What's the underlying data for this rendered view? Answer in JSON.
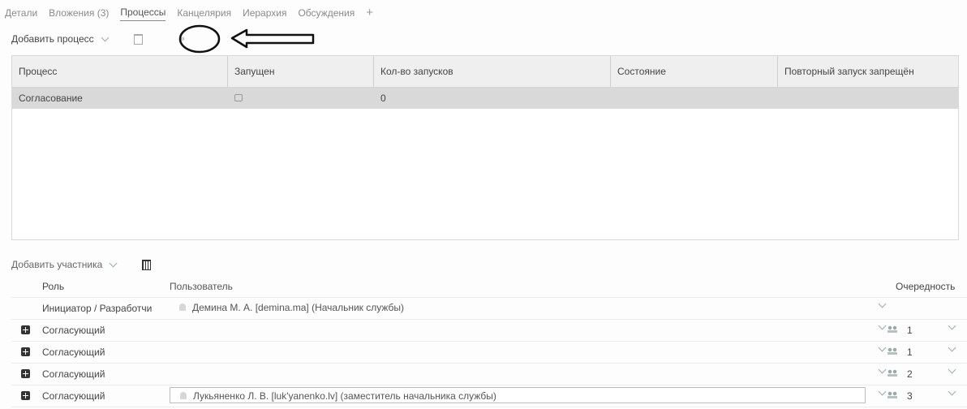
{
  "tabs": [
    {
      "label": "Детали"
    },
    {
      "label": "Вложения (3)"
    },
    {
      "label": "Процессы"
    },
    {
      "label": "Канцелярия"
    },
    {
      "label": "Иерархия"
    },
    {
      "label": "Обсуждения"
    },
    {
      "label": "+"
    }
  ],
  "active_tab": "Процессы",
  "process_toolbar": {
    "add_label": "Добавить процесс",
    "more_label": "»"
  },
  "process_grid": {
    "columns": [
      "Процесс",
      "Запущен",
      "Кол-во запусков",
      "Состояние",
      "Повторный запуск запрещён"
    ],
    "rows": [
      {
        "process": "Согласование",
        "started": false,
        "runs": "0",
        "state": "",
        "restart_forbidden": ""
      }
    ]
  },
  "participants_toolbar": {
    "add_label": "Добавить участника"
  },
  "participants_grid": {
    "columns": {
      "role": "Роль",
      "user": "Пользователь",
      "order": "Очередность"
    },
    "rows": [
      {
        "role": "Инициатор / Разработчи",
        "user": "Демина М. А. [demina.ma] (Начальник службы)",
        "order": "",
        "has_plus": false
      },
      {
        "role": "Согласующий",
        "user": "",
        "order": "1",
        "has_plus": true
      },
      {
        "role": "Согласующий",
        "user": "",
        "order": "1",
        "has_plus": true
      },
      {
        "role": "Согласующий",
        "user": "",
        "order": "2",
        "has_plus": true
      },
      {
        "role": "Согласующий",
        "user": "Лукьяненко Л. В. [luk'yanenko.lv] (заместитель начальника службы)",
        "order": "3",
        "has_plus": true
      }
    ]
  },
  "colors": {
    "selected_row": "#d9d9d9",
    "header_bg": "#efefef",
    "annotation": "#111111"
  }
}
